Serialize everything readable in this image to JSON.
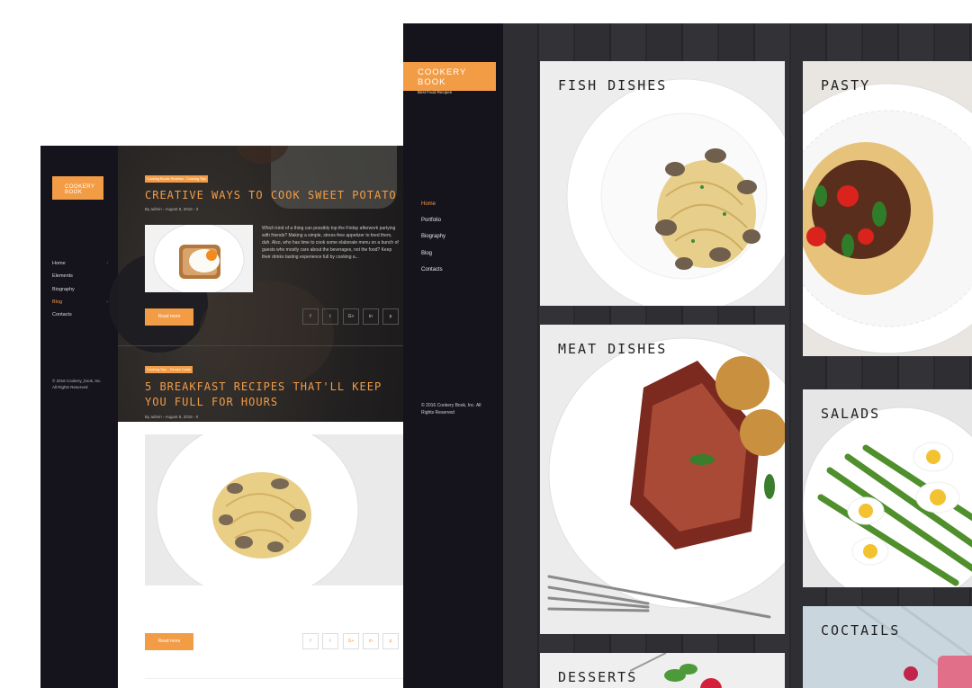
{
  "blog": {
    "logo": "COOKERY BOOK",
    "nav": [
      {
        "label": "Home",
        "caret": "›",
        "active": false
      },
      {
        "label": "Elements",
        "caret": "",
        "active": false
      },
      {
        "label": "Biography",
        "caret": "",
        "active": false
      },
      {
        "label": "Blog",
        "caret": "›",
        "active": true
      },
      {
        "label": "Contacts",
        "caret": "",
        "active": false
      }
    ],
    "copyright": "© 2016 Cookery_book, Inc. All Rights Reserved",
    "posts": [
      {
        "tags": [
          "Cooking Books Reviews",
          "Cooking Tips"
        ],
        "title": "CREATIVE WAYS TO COOK SWEET POTATO",
        "meta": "By admin - August 8, 2016 - 3",
        "excerpt": "Which kind of a thing can possibly top the Friday afterwork partying with friends? Making a simple, stress-free appetizer to feed them, duh. Also, who has time to cook some elaborate menu on a bunch of guests who mostly care about the beverages, not the food? Keep their drinks tasting experience full by cooking a...",
        "read_more": "Read more"
      },
      {
        "tags": [
          "Cooking Tips",
          "Recipe Cards"
        ],
        "title": "5 BREAKFAST RECIPES THAT'LL KEEP YOU FULL FOR HOURS",
        "meta": "By admin - August 8, 2016 - 0",
        "read_more": "Read more"
      }
    ],
    "social": [
      "f",
      "t",
      "G+",
      "in",
      "p"
    ]
  },
  "portfolio": {
    "logo_title": "COOKERY BOOK",
    "logo_subtitle": "Best Food Recipes",
    "nav": [
      {
        "label": "Home",
        "active": true
      },
      {
        "label": "Portfolio",
        "active": false
      },
      {
        "label": "Biography",
        "active": false
      },
      {
        "label": "Blog",
        "active": false
      },
      {
        "label": "Contacts",
        "active": false
      }
    ],
    "copyright": "© 2016 Cookery Book, Inc. All Rights Reserved",
    "categories": [
      {
        "label": "FISH DISHES",
        "selected": true
      },
      {
        "label": "PASTY",
        "selected": false
      },
      {
        "label": "MEAT DISHES",
        "selected": false
      },
      {
        "label": "SALADS",
        "selected": false
      },
      {
        "label": "COCTAILS",
        "selected": false
      },
      {
        "label": "DESSERTS",
        "selected": false
      }
    ]
  },
  "colors": {
    "accent": "#f39c46",
    "dark": "#15141d"
  }
}
